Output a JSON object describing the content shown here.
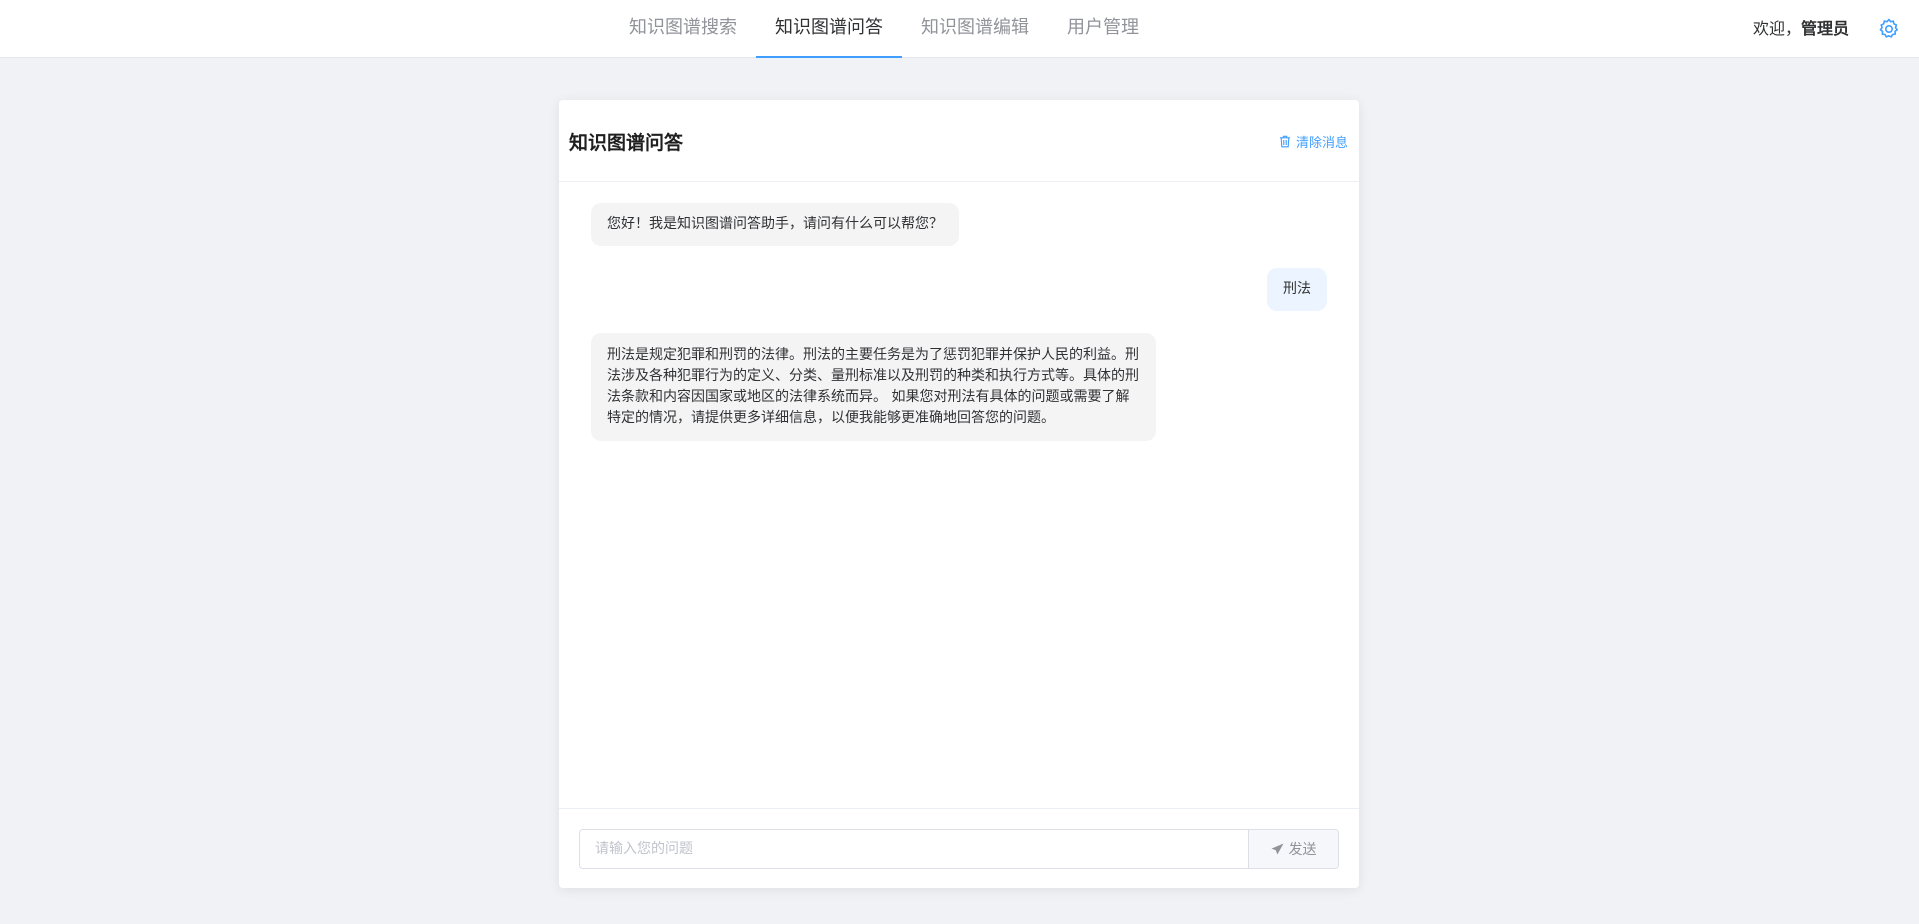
{
  "nav": {
    "tabs": [
      {
        "label": "知识图谱搜索"
      },
      {
        "label": "知识图谱问答"
      },
      {
        "label": "知识图谱编辑"
      },
      {
        "label": "用户管理"
      }
    ],
    "active_tab": "知识图谱问答"
  },
  "user": {
    "welcome": "欢迎，",
    "name": "管理员"
  },
  "card": {
    "title": "知识图谱问答",
    "clear_label": "清除消息"
  },
  "messages": [
    {
      "role": "bot",
      "text": "您好！我是知识图谱问答助手，请问有什么可以帮您？"
    },
    {
      "role": "user",
      "text": "刑法"
    },
    {
      "role": "bot",
      "text": "刑法是规定犯罪和刑罚的法律。刑法的主要任务是为了惩罚犯罪并保护人民的利益。刑法涉及各种犯罪行为的定义、分类、量刑标准以及刑罚的种类和执行方式等。具体的刑法条款和内容因国家或地区的法律系统而异。 如果您对刑法有具体的问题或需要了解特定的情况，请提供更多详细信息，以便我能够更准确地回答您的问题。"
    }
  ],
  "input": {
    "value": "",
    "placeholder": "请输入您的问题",
    "send_label": "发送"
  },
  "colors": {
    "accent": "#409eff",
    "page_bg": "#f0f2f5",
    "bot_bubble": "#f4f4f5",
    "user_bubble": "#ecf5ff"
  },
  "icons": {
    "settings": "gear-icon",
    "clear": "trash-icon",
    "send": "paper-plane-icon"
  }
}
